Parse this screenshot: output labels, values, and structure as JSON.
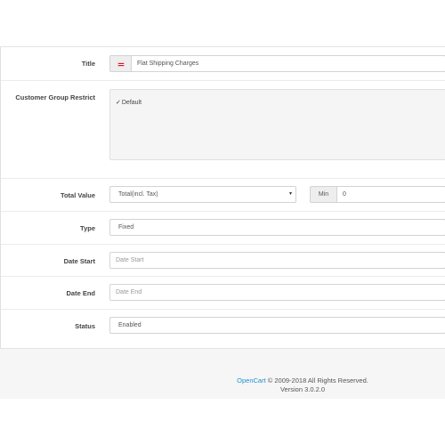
{
  "form": {
    "title": {
      "label": "Title",
      "value": "Flat Shipping Charges",
      "flag_icon": "uk-flag-icon"
    },
    "customer_group": {
      "label": "Customer Group Restrict",
      "option": "Default",
      "checked": true
    },
    "total_value": {
      "label": "Total Value",
      "selected": "Total(incl. Tax)",
      "addon": "Min",
      "min_value": "0"
    },
    "type": {
      "label": "Type",
      "value": "Fixed"
    },
    "date_start": {
      "label": "Date Start",
      "placeholder": "Date Start"
    },
    "date_end": {
      "label": "Date End",
      "placeholder": "Date End"
    },
    "status": {
      "label": "Status",
      "value": "Enabled"
    }
  },
  "footer": {
    "brand": "OpenCart",
    "copyright": "© 2009-2018 All Rights Reserved.",
    "version": "Version 3.0.2.0"
  }
}
